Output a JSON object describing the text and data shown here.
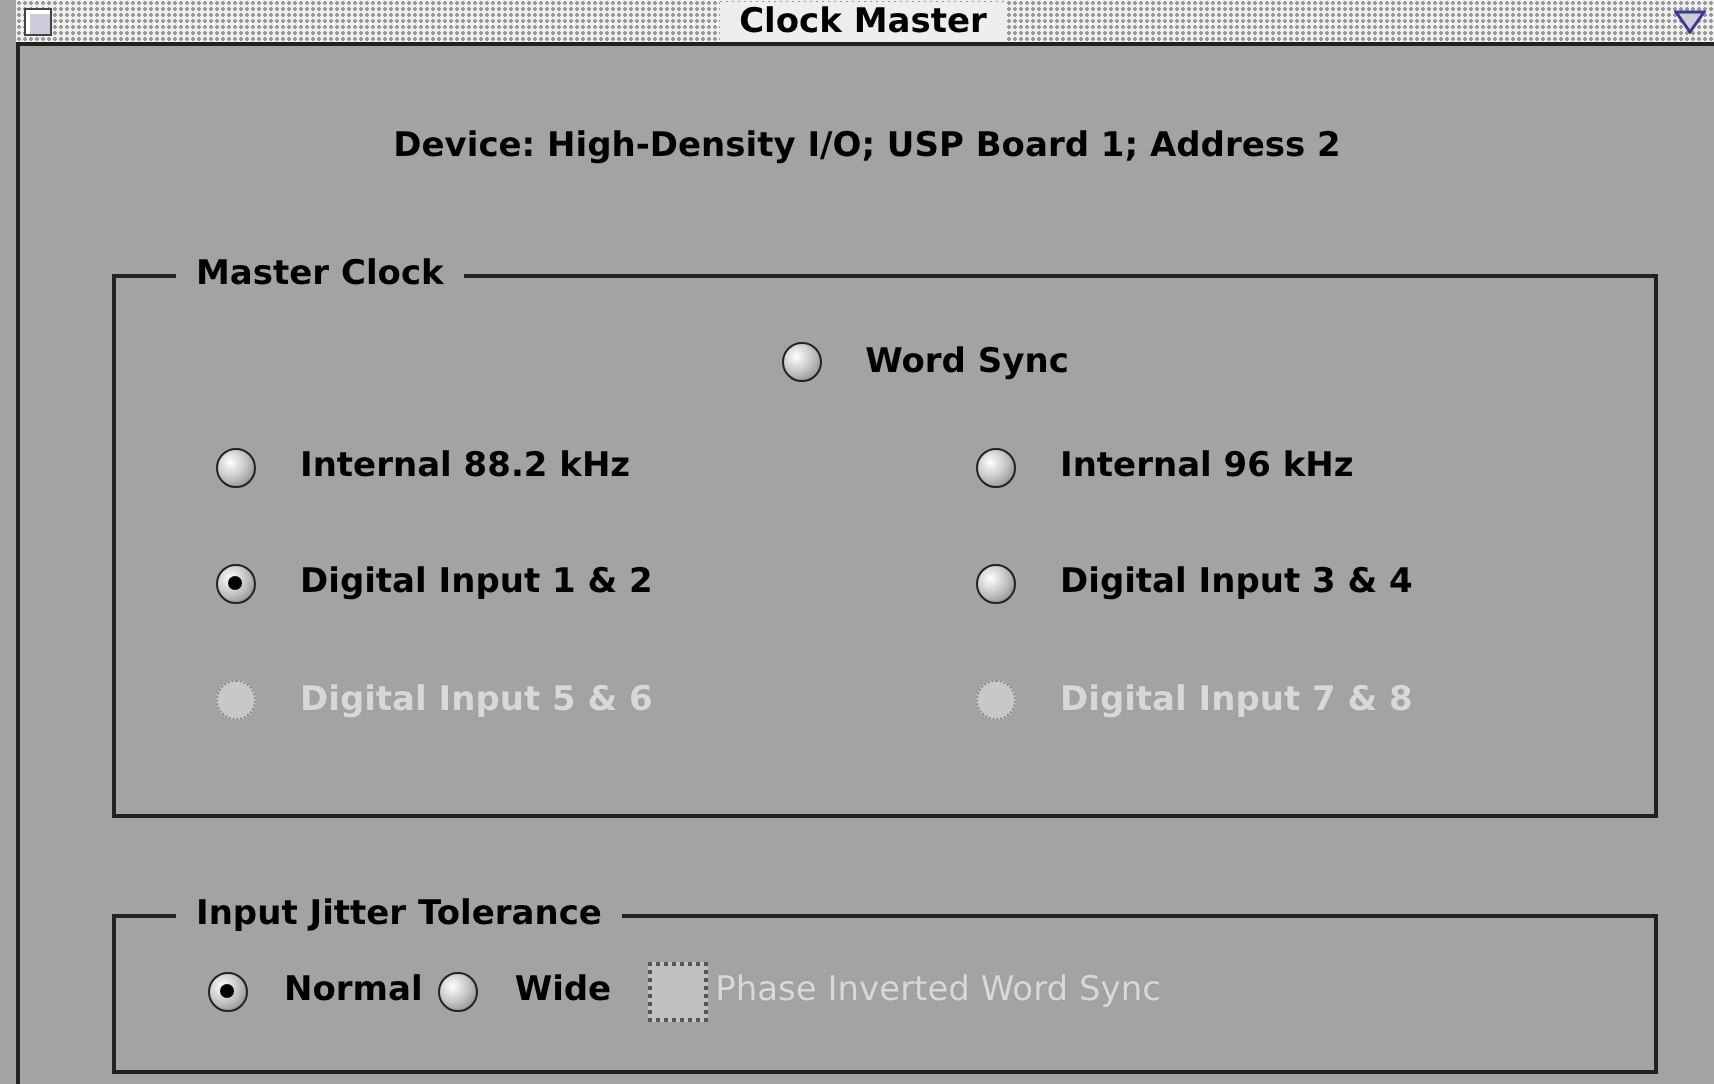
{
  "window": {
    "title": "Clock Master"
  },
  "device": "Device: High-Density I/O; USP Board 1; Address 2",
  "master_clock": {
    "title": "Master Clock",
    "word_sync": {
      "label": "Word Sync",
      "selected": false,
      "disabled": false
    },
    "options": [
      {
        "label": "Internal 88.2 kHz",
        "selected": false,
        "disabled": false
      },
      {
        "label": "Internal 96 kHz",
        "selected": false,
        "disabled": false
      },
      {
        "label": "Digital Input 1 & 2",
        "selected": true,
        "disabled": false
      },
      {
        "label": "Digital Input 3 & 4",
        "selected": false,
        "disabled": false
      },
      {
        "label": "Digital Input 5 & 6",
        "selected": false,
        "disabled": true
      },
      {
        "label": "Digital Input 7 & 8",
        "selected": false,
        "disabled": true
      }
    ]
  },
  "jitter": {
    "title": "Input Jitter Tolerance",
    "options": [
      {
        "label": "Normal",
        "selected": true,
        "disabled": false
      },
      {
        "label": "Wide",
        "selected": false,
        "disabled": false
      }
    ],
    "checkbox": {
      "label": "Phase Inverted Word Sync",
      "checked": false,
      "disabled": true
    }
  }
}
